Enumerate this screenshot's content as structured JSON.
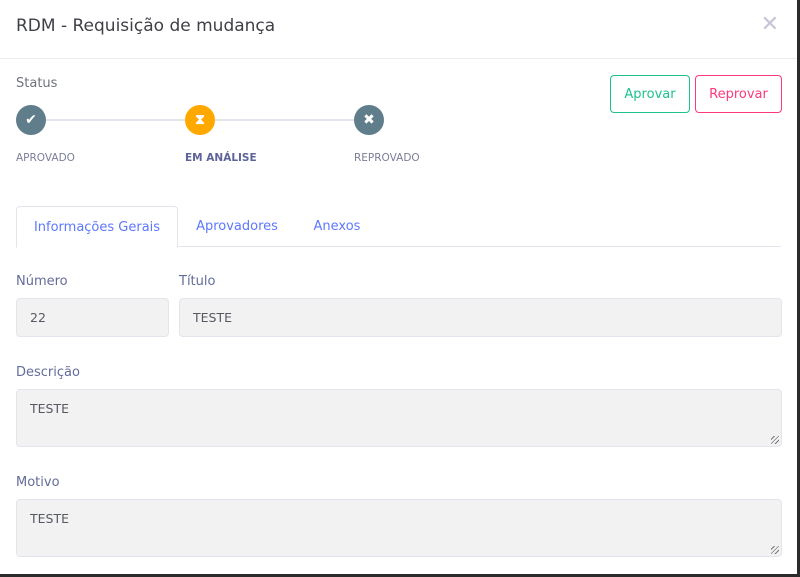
{
  "modal": {
    "title": "RDM - Requisição de mudança",
    "close_icon": "close-icon"
  },
  "status": {
    "label": "Status",
    "steps": [
      {
        "label": "APROVADO",
        "icon": "check-icon",
        "color": "#607d8b",
        "current": false
      },
      {
        "label": "EM ANÁLISE",
        "icon": "hourglass-icon",
        "color": "#ffa800",
        "current": true
      },
      {
        "label": "REPROVADO",
        "icon": "x-icon",
        "color": "#607d8b",
        "current": false
      }
    ]
  },
  "actions": {
    "approve": "Aprovar",
    "reject": "Reprovar",
    "approve_color": "#1dc18d",
    "reject_color": "#fd397a"
  },
  "tabs": [
    {
      "label": "Informações Gerais",
      "active": true
    },
    {
      "label": "Aprovadores",
      "active": false
    },
    {
      "label": "Anexos",
      "active": false
    }
  ],
  "form": {
    "numero": {
      "label": "Número",
      "value": "22"
    },
    "titulo": {
      "label": "Título",
      "value": "TESTE"
    },
    "descricao": {
      "label": "Descrição",
      "value": "TESTE"
    },
    "motivo": {
      "label": "Motivo",
      "value": "TESTE"
    }
  }
}
